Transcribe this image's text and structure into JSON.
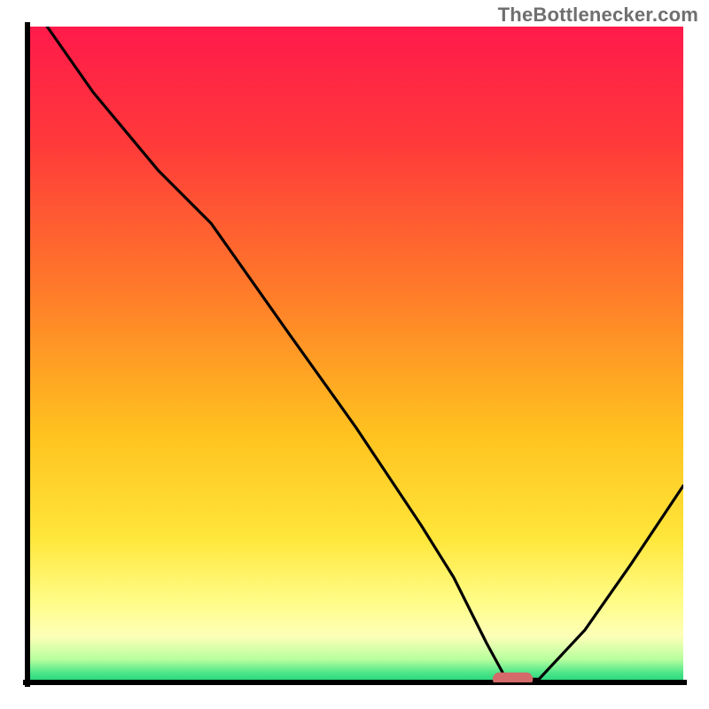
{
  "watermark": {
    "text": "TheBottlenecker.com"
  },
  "colors": {
    "axis": "#000000",
    "curve": "#000000",
    "marker_fill": "#d46a6a",
    "marker_stroke": "#d46a6a",
    "gradient_stops": [
      {
        "offset": 0.0,
        "color": "#ff1a4b"
      },
      {
        "offset": 0.18,
        "color": "#ff3a3a"
      },
      {
        "offset": 0.4,
        "color": "#ff7a2a"
      },
      {
        "offset": 0.62,
        "color": "#ffc21f"
      },
      {
        "offset": 0.78,
        "color": "#ffe63a"
      },
      {
        "offset": 0.88,
        "color": "#fffd8a"
      },
      {
        "offset": 0.93,
        "color": "#fdffb8"
      },
      {
        "offset": 0.965,
        "color": "#b7ff9e"
      },
      {
        "offset": 0.985,
        "color": "#4fe68a"
      },
      {
        "offset": 1.0,
        "color": "#1fd47a"
      }
    ]
  },
  "chart_data": {
    "type": "line",
    "title": "",
    "xlabel": "",
    "ylabel": "",
    "xlim": [
      0,
      100
    ],
    "ylim": [
      0,
      100
    ],
    "note": "Bottleneck curve: y ≈ percentage bottleneck vs. x (normalized component scale). Values estimated from pixel positions.",
    "series": [
      {
        "name": "bottleneck-curve",
        "x": [
          3,
          10,
          20,
          28,
          40,
          50,
          60,
          65,
          70,
          73,
          78,
          85,
          92,
          100
        ],
        "y": [
          100,
          90,
          78,
          70,
          53,
          39,
          24,
          16,
          6,
          0.5,
          0.5,
          8,
          18,
          30
        ]
      }
    ],
    "marker": {
      "name": "optimal-range",
      "x_start": 71,
      "x_end": 77,
      "y": 0.5
    }
  }
}
